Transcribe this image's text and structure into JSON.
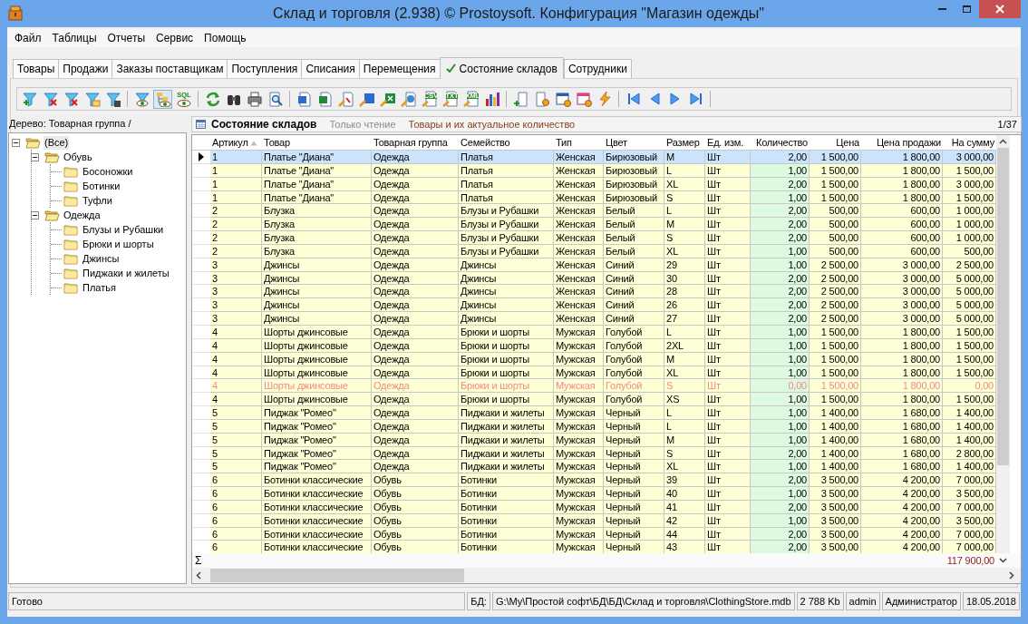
{
  "window": {
    "title": "Склад и торговля (2.938) © Prostoysoft. Конфигурация \"Магазин одежды\""
  },
  "menu": [
    "Файл",
    "Таблицы",
    "Отчеты",
    "Сервис",
    "Помощь"
  ],
  "tabs": [
    {
      "label": "Товары",
      "selected": false
    },
    {
      "label": "Продажи",
      "selected": false
    },
    {
      "label": "Заказы поставщикам",
      "selected": false
    },
    {
      "label": "Поступления",
      "selected": false
    },
    {
      "label": "Списания",
      "selected": false
    },
    {
      "label": "Перемещения",
      "selected": false
    },
    {
      "label": "Состояние складов",
      "selected": true
    },
    {
      "label": "Сотрудники",
      "selected": false
    }
  ],
  "toolbar": [
    {
      "kind": "filter-add",
      "pressed": false
    },
    {
      "kind": "filter-remove",
      "pressed": false
    },
    {
      "kind": "filter-remove",
      "pressed": false
    },
    {
      "kind": "filter-folder",
      "pressed": false
    },
    {
      "kind": "filter-save",
      "pressed": false
    },
    {
      "kind": "separator"
    },
    {
      "kind": "filter-eye",
      "pressed": false
    },
    {
      "kind": "tree-eye",
      "pressed": true
    },
    {
      "kind": "sql-eye",
      "label": "SQL",
      "pressed": false
    },
    {
      "kind": "separator"
    },
    {
      "kind": "refresh",
      "pressed": false
    },
    {
      "kind": "binoculars",
      "pressed": false
    },
    {
      "kind": "printer",
      "pressed": false
    },
    {
      "kind": "preview",
      "pressed": false
    },
    {
      "kind": "separator"
    },
    {
      "kind": "word",
      "pressed": false
    },
    {
      "kind": "excel",
      "pressed": false
    },
    {
      "kind": "export-doc",
      "pressed": false
    },
    {
      "kind": "export-word",
      "pressed": false
    },
    {
      "kind": "export-excel",
      "pressed": false
    },
    {
      "kind": "export-web",
      "pressed": false
    },
    {
      "kind": "export-file",
      "label": "CSV",
      "pressed": false
    },
    {
      "kind": "export-file",
      "label": "TXT",
      "pressed": false
    },
    {
      "kind": "export-file",
      "label": "XML",
      "pressed": false
    },
    {
      "kind": "chart",
      "pressed": false
    },
    {
      "kind": "separator"
    },
    {
      "kind": "add-doc",
      "pressed": false
    },
    {
      "kind": "doc-gear",
      "pressed": false
    },
    {
      "kind": "table-gear",
      "pressed": false
    },
    {
      "kind": "table-settings",
      "pressed": false
    },
    {
      "kind": "lightning",
      "pressed": false
    },
    {
      "kind": "separator"
    },
    {
      "kind": "first",
      "pressed": false
    },
    {
      "kind": "prev",
      "pressed": false
    },
    {
      "kind": "next",
      "pressed": false
    },
    {
      "kind": "last",
      "pressed": false
    },
    {
      "kind": "separator"
    }
  ],
  "tree": {
    "caption": "Дерево: Товарная группа /",
    "nodes": [
      {
        "label": "(Все)",
        "selected": true,
        "expanded": true,
        "children": [
          {
            "label": "Обувь",
            "selected": false,
            "expanded": true,
            "children": [
              {
                "label": "Босоножки",
                "selected": false
              },
              {
                "label": "Ботинки",
                "selected": false
              },
              {
                "label": "Туфли",
                "selected": false
              }
            ]
          },
          {
            "label": "Одежда",
            "selected": false,
            "expanded": true,
            "children": [
              {
                "label": "Блузы и Рубашки",
                "selected": false
              },
              {
                "label": "Брюки и шорты",
                "selected": false
              },
              {
                "label": "Джинсы",
                "selected": false
              },
              {
                "label": "Пиджаки и жилеты",
                "selected": false
              },
              {
                "label": "Платья",
                "selected": false
              }
            ]
          }
        ]
      }
    ]
  },
  "grid": {
    "title": "Состояние складов",
    "mode": "Только чтение",
    "description": "Товары и их актуальное количество",
    "position": "1/37",
    "columns": [
      {
        "label": "Артикул",
        "sorted": true
      },
      {
        "label": "Товар",
        "sorted": false
      },
      {
        "label": "Товарная группа",
        "sorted": false
      },
      {
        "label": "Семейство",
        "sorted": false
      },
      {
        "label": "Тип",
        "sorted": false
      },
      {
        "label": "Цвет",
        "sorted": false
      },
      {
        "label": "Размер",
        "sorted": false
      },
      {
        "label": "Ед. изм.",
        "sorted": false
      },
      {
        "label": "Количество",
        "sorted": false
      },
      {
        "label": "Цена",
        "sorted": false
      },
      {
        "label": "Цена продажи",
        "sorted": false
      },
      {
        "label": "На сумму",
        "sorted": false
      }
    ],
    "rows": [
      {
        "selected": true,
        "inactive": false,
        "cells": [
          "1",
          "Платье \"Диана\"",
          "Одежда",
          "Платья",
          "Женская",
          "Бирюзовый",
          "M",
          "Шт",
          "2,00",
          "1 500,00",
          "1 800,00",
          "3 000,00"
        ]
      },
      {
        "selected": false,
        "inactive": false,
        "cells": [
          "1",
          "Платье \"Диана\"",
          "Одежда",
          "Платья",
          "Женская",
          "Бирюзовый",
          "L",
          "Шт",
          "1,00",
          "1 500,00",
          "1 800,00",
          "1 500,00"
        ]
      },
      {
        "selected": false,
        "inactive": false,
        "cells": [
          "1",
          "Платье \"Диана\"",
          "Одежда",
          "Платья",
          "Женская",
          "Бирюзовый",
          "XL",
          "Шт",
          "2,00",
          "1 500,00",
          "1 800,00",
          "3 000,00"
        ]
      },
      {
        "selected": false,
        "inactive": false,
        "cells": [
          "1",
          "Платье \"Диана\"",
          "Одежда",
          "Платья",
          "Женская",
          "Бирюзовый",
          "S",
          "Шт",
          "1,00",
          "1 500,00",
          "1 800,00",
          "1 500,00"
        ]
      },
      {
        "selected": false,
        "inactive": false,
        "cells": [
          "2",
          "Блузка",
          "Одежда",
          "Блузы и Рубашки",
          "Женская",
          "Белый",
          "L",
          "Шт",
          "2,00",
          "500,00",
          "600,00",
          "1 000,00"
        ]
      },
      {
        "selected": false,
        "inactive": false,
        "cells": [
          "2",
          "Блузка",
          "Одежда",
          "Блузы и Рубашки",
          "Женская",
          "Белый",
          "M",
          "Шт",
          "2,00",
          "500,00",
          "600,00",
          "1 000,00"
        ]
      },
      {
        "selected": false,
        "inactive": false,
        "cells": [
          "2",
          "Блузка",
          "Одежда",
          "Блузы и Рубашки",
          "Женская",
          "Белый",
          "S",
          "Шт",
          "2,00",
          "500,00",
          "600,00",
          "1 000,00"
        ]
      },
      {
        "selected": false,
        "inactive": false,
        "cells": [
          "2",
          "Блузка",
          "Одежда",
          "Блузы и Рубашки",
          "Женская",
          "Белый",
          "XL",
          "Шт",
          "1,00",
          "500,00",
          "600,00",
          "500,00"
        ]
      },
      {
        "selected": false,
        "inactive": false,
        "cells": [
          "3",
          "Джинсы",
          "Одежда",
          "Джинсы",
          "Женская",
          "Синий",
          "29",
          "Шт",
          "1,00",
          "2 500,00",
          "3 000,00",
          "2 500,00"
        ]
      },
      {
        "selected": false,
        "inactive": false,
        "cells": [
          "3",
          "Джинсы",
          "Одежда",
          "Джинсы",
          "Женская",
          "Синий",
          "30",
          "Шт",
          "2,00",
          "2 500,00",
          "3 000,00",
          "5 000,00"
        ]
      },
      {
        "selected": false,
        "inactive": false,
        "cells": [
          "3",
          "Джинсы",
          "Одежда",
          "Джинсы",
          "Женская",
          "Синий",
          "28",
          "Шт",
          "2,00",
          "2 500,00",
          "3 000,00",
          "5 000,00"
        ]
      },
      {
        "selected": false,
        "inactive": false,
        "cells": [
          "3",
          "Джинсы",
          "Одежда",
          "Джинсы",
          "Женская",
          "Синий",
          "26",
          "Шт",
          "2,00",
          "2 500,00",
          "3 000,00",
          "5 000,00"
        ]
      },
      {
        "selected": false,
        "inactive": false,
        "cells": [
          "3",
          "Джинсы",
          "Одежда",
          "Джинсы",
          "Женская",
          "Синий",
          "27",
          "Шт",
          "2,00",
          "2 500,00",
          "3 000,00",
          "5 000,00"
        ]
      },
      {
        "selected": false,
        "inactive": false,
        "cells": [
          "4",
          "Шорты джинсовые",
          "Одежда",
          "Брюки и шорты",
          "Мужская",
          "Голубой",
          "L",
          "Шт",
          "1,00",
          "1 500,00",
          "1 800,00",
          "1 500,00"
        ]
      },
      {
        "selected": false,
        "inactive": false,
        "cells": [
          "4",
          "Шорты джинсовые",
          "Одежда",
          "Брюки и шорты",
          "Мужская",
          "Голубой",
          "2XL",
          "Шт",
          "1,00",
          "1 500,00",
          "1 800,00",
          "1 500,00"
        ]
      },
      {
        "selected": false,
        "inactive": false,
        "cells": [
          "4",
          "Шорты джинсовые",
          "Одежда",
          "Брюки и шорты",
          "Мужская",
          "Голубой",
          "M",
          "Шт",
          "1,00",
          "1 500,00",
          "1 800,00",
          "1 500,00"
        ]
      },
      {
        "selected": false,
        "inactive": false,
        "cells": [
          "4",
          "Шорты джинсовые",
          "Одежда",
          "Брюки и шорты",
          "Мужская",
          "Голубой",
          "XL",
          "Шт",
          "1,00",
          "1 500,00",
          "1 800,00",
          "1 500,00"
        ]
      },
      {
        "selected": false,
        "inactive": true,
        "cells": [
          "4",
          "Шорты джинсовые",
          "Одежда",
          "Брюки и шорты",
          "Мужская",
          "Голубой",
          "S",
          "Шт",
          "0,00",
          "1 500,00",
          "1 800,00",
          "0,00"
        ]
      },
      {
        "selected": false,
        "inactive": false,
        "cells": [
          "4",
          "Шорты джинсовые",
          "Одежда",
          "Брюки и шорты",
          "Мужская",
          "Голубой",
          "XS",
          "Шт",
          "1,00",
          "1 500,00",
          "1 800,00",
          "1 500,00"
        ]
      },
      {
        "selected": false,
        "inactive": false,
        "cells": [
          "5",
          "Пиджак \"Ромео\"",
          "Одежда",
          "Пиджаки и жилеты",
          "Мужская",
          "Черный",
          "L",
          "Шт",
          "1,00",
          "1 400,00",
          "1 680,00",
          "1 400,00"
        ]
      },
      {
        "selected": false,
        "inactive": false,
        "cells": [
          "5",
          "Пиджак \"Ромео\"",
          "Одежда",
          "Пиджаки и жилеты",
          "Мужская",
          "Черный",
          "L",
          "Шт",
          "1,00",
          "1 400,00",
          "1 680,00",
          "1 400,00"
        ]
      },
      {
        "selected": false,
        "inactive": false,
        "cells": [
          "5",
          "Пиджак \"Ромео\"",
          "Одежда",
          "Пиджаки и жилеты",
          "Мужская",
          "Черный",
          "M",
          "Шт",
          "1,00",
          "1 400,00",
          "1 680,00",
          "1 400,00"
        ]
      },
      {
        "selected": false,
        "inactive": false,
        "cells": [
          "5",
          "Пиджак \"Ромео\"",
          "Одежда",
          "Пиджаки и жилеты",
          "Мужская",
          "Черный",
          "S",
          "Шт",
          "2,00",
          "1 400,00",
          "1 680,00",
          "2 800,00"
        ]
      },
      {
        "selected": false,
        "inactive": false,
        "cells": [
          "5",
          "Пиджак \"Ромео\"",
          "Одежда",
          "Пиджаки и жилеты",
          "Мужская",
          "Черный",
          "XL",
          "Шт",
          "1,00",
          "1 400,00",
          "1 680,00",
          "1 400,00"
        ]
      },
      {
        "selected": false,
        "inactive": false,
        "cells": [
          "6",
          "Ботинки классические",
          "Обувь",
          "Ботинки",
          "Мужская",
          "Черный",
          "39",
          "Шт",
          "2,00",
          "3 500,00",
          "4 200,00",
          "7 000,00"
        ]
      },
      {
        "selected": false,
        "inactive": false,
        "cells": [
          "6",
          "Ботинки классические",
          "Обувь",
          "Ботинки",
          "Мужская",
          "Черный",
          "40",
          "Шт",
          "1,00",
          "3 500,00",
          "4 200,00",
          "3 500,00"
        ]
      },
      {
        "selected": false,
        "inactive": false,
        "cells": [
          "6",
          "Ботинки классические",
          "Обувь",
          "Ботинки",
          "Мужская",
          "Черный",
          "41",
          "Шт",
          "2,00",
          "3 500,00",
          "4 200,00",
          "7 000,00"
        ]
      },
      {
        "selected": false,
        "inactive": false,
        "cells": [
          "6",
          "Ботинки классические",
          "Обувь",
          "Ботинки",
          "Мужская",
          "Черный",
          "42",
          "Шт",
          "1,00",
          "3 500,00",
          "4 200,00",
          "3 500,00"
        ]
      },
      {
        "selected": false,
        "inactive": false,
        "cells": [
          "6",
          "Ботинки классические",
          "Обувь",
          "Ботинки",
          "Мужская",
          "Черный",
          "44",
          "Шт",
          "2,00",
          "3 500,00",
          "4 200,00",
          "7 000,00"
        ]
      },
      {
        "selected": false,
        "inactive": false,
        "cells": [
          "6",
          "Ботинки классические",
          "Обувь",
          "Ботинки",
          "Мужская",
          "Черный",
          "43",
          "Шт",
          "2,00",
          "3 500,00",
          "4 200,00",
          "7 000,00"
        ]
      }
    ],
    "sum_symbol": "Σ",
    "total": "117 900,00"
  },
  "status_bar": {
    "state": "Готово",
    "db_label": "БД:",
    "db_path": "G:\\My\\Простой софт\\БД\\БД\\Склад и торговля\\ClothingStore.mdb",
    "db_size": "2 788 Kb",
    "user": "admin",
    "role": "Администратор",
    "date": "18.05.2018"
  }
}
